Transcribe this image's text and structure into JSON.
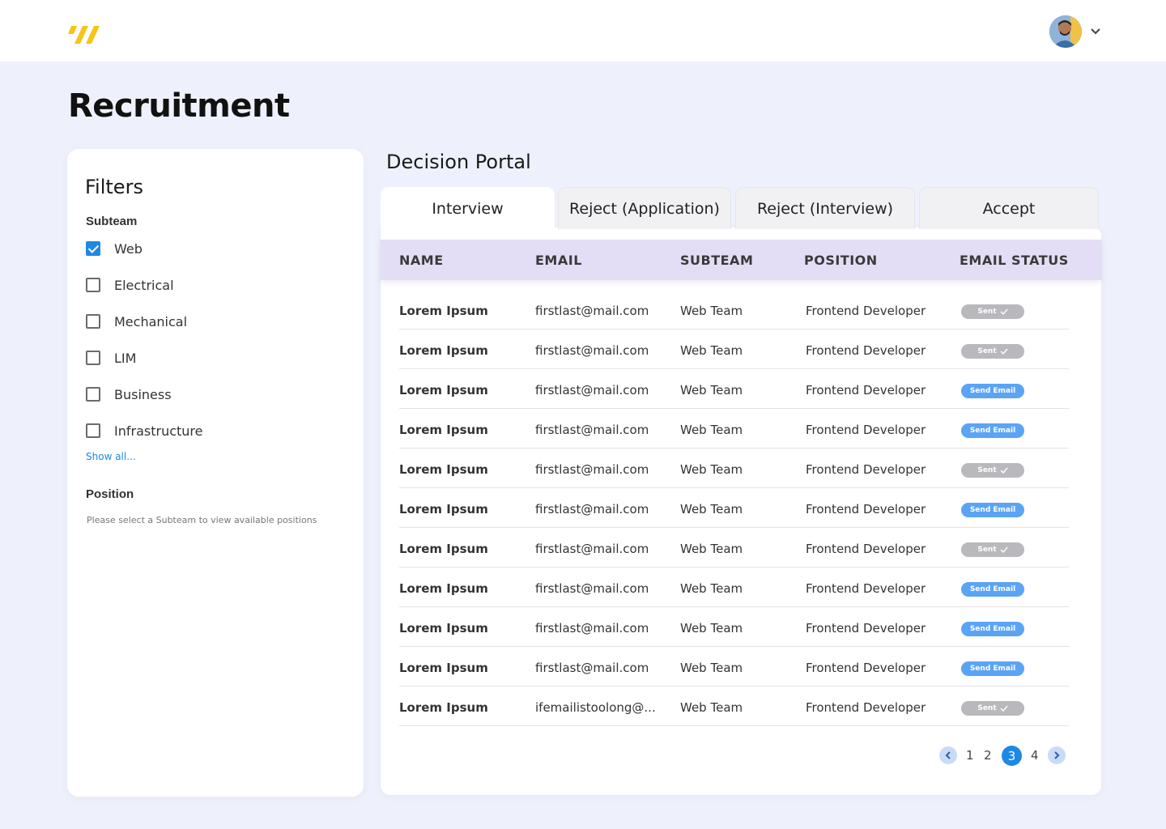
{
  "header": {
    "brand_color": "#f5c518",
    "logo_icon": "double-slash-logo",
    "avatar_icon": "user-avatar",
    "menu_icon": "chevron-down-icon"
  },
  "page": {
    "title": "Recruitment"
  },
  "filters": {
    "title": "Filters",
    "subteam_heading": "Subteam",
    "subteams": [
      {
        "label": "Web",
        "checked": true
      },
      {
        "label": "Electrical",
        "checked": false
      },
      {
        "label": "Mechanical",
        "checked": false
      },
      {
        "label": "LIM",
        "checked": false
      },
      {
        "label": "Business",
        "checked": false
      },
      {
        "label": "Infrastructure",
        "checked": false
      }
    ],
    "show_all": "Show all...",
    "position_heading": "Position",
    "position_help": "Please select a Subteam to view available positions"
  },
  "portal": {
    "title": "Decision Portal",
    "tabs": [
      {
        "label": "Interview",
        "active": true
      },
      {
        "label": "Reject (Application)",
        "active": false
      },
      {
        "label": "Reject (Interview)",
        "active": false
      },
      {
        "label": "Accept",
        "active": false
      }
    ],
    "columns": [
      "NAME",
      "EMAIL",
      "SUBTEAM",
      "POSITION",
      "EMAIL STATUS"
    ],
    "header_color": "#e4ddf6",
    "rows": [
      {
        "name": "Lorem Ipsum",
        "email": "firstlast@mail.com",
        "subteam": "Web Team",
        "position": "Frontend Developer",
        "status": "Sent",
        "status_type": "sent"
      },
      {
        "name": "Lorem Ipsum",
        "email": "firstlast@mail.com",
        "subteam": "Web Team",
        "position": "Frontend Developer",
        "status": "Sent",
        "status_type": "sent"
      },
      {
        "name": "Lorem Ipsum",
        "email": "firstlast@mail.com",
        "subteam": "Web Team",
        "position": "Frontend Developer",
        "status": "Send Email",
        "status_type": "send"
      },
      {
        "name": "Lorem Ipsum",
        "email": "firstlast@mail.com",
        "subteam": "Web Team",
        "position": "Frontend Developer",
        "status": "Send Email",
        "status_type": "send"
      },
      {
        "name": "Lorem Ipsum",
        "email": "firstlast@mail.com",
        "subteam": "Web Team",
        "position": "Frontend Developer",
        "status": "Sent",
        "status_type": "sent"
      },
      {
        "name": "Lorem Ipsum",
        "email": "firstlast@mail.com",
        "subteam": "Web Team",
        "position": "Frontend Developer",
        "status": "Send Email",
        "status_type": "send"
      },
      {
        "name": "Lorem Ipsum",
        "email": "firstlast@mail.com",
        "subteam": "Web Team",
        "position": "Frontend Developer",
        "status": "Sent",
        "status_type": "sent"
      },
      {
        "name": "Lorem Ipsum",
        "email": "firstlast@mail.com",
        "subteam": "Web Team",
        "position": "Frontend Developer",
        "status": "Send Email",
        "status_type": "send"
      },
      {
        "name": "Lorem Ipsum",
        "email": "firstlast@mail.com",
        "subteam": "Web Team",
        "position": "Frontend Developer",
        "status": "Send Email",
        "status_type": "send"
      },
      {
        "name": "Lorem Ipsum",
        "email": "firstlast@mail.com",
        "subteam": "Web Team",
        "position": "Frontend Developer",
        "status": "Send Email",
        "status_type": "send"
      },
      {
        "name": "Lorem Ipsum",
        "email": "ifemailistoolong@...",
        "subteam": "Web Team",
        "position": "Frontend Developer",
        "status": "Sent",
        "status_type": "sent"
      }
    ],
    "pagination": {
      "pages": [
        "1",
        "2",
        "3",
        "4"
      ],
      "current": "3"
    }
  }
}
